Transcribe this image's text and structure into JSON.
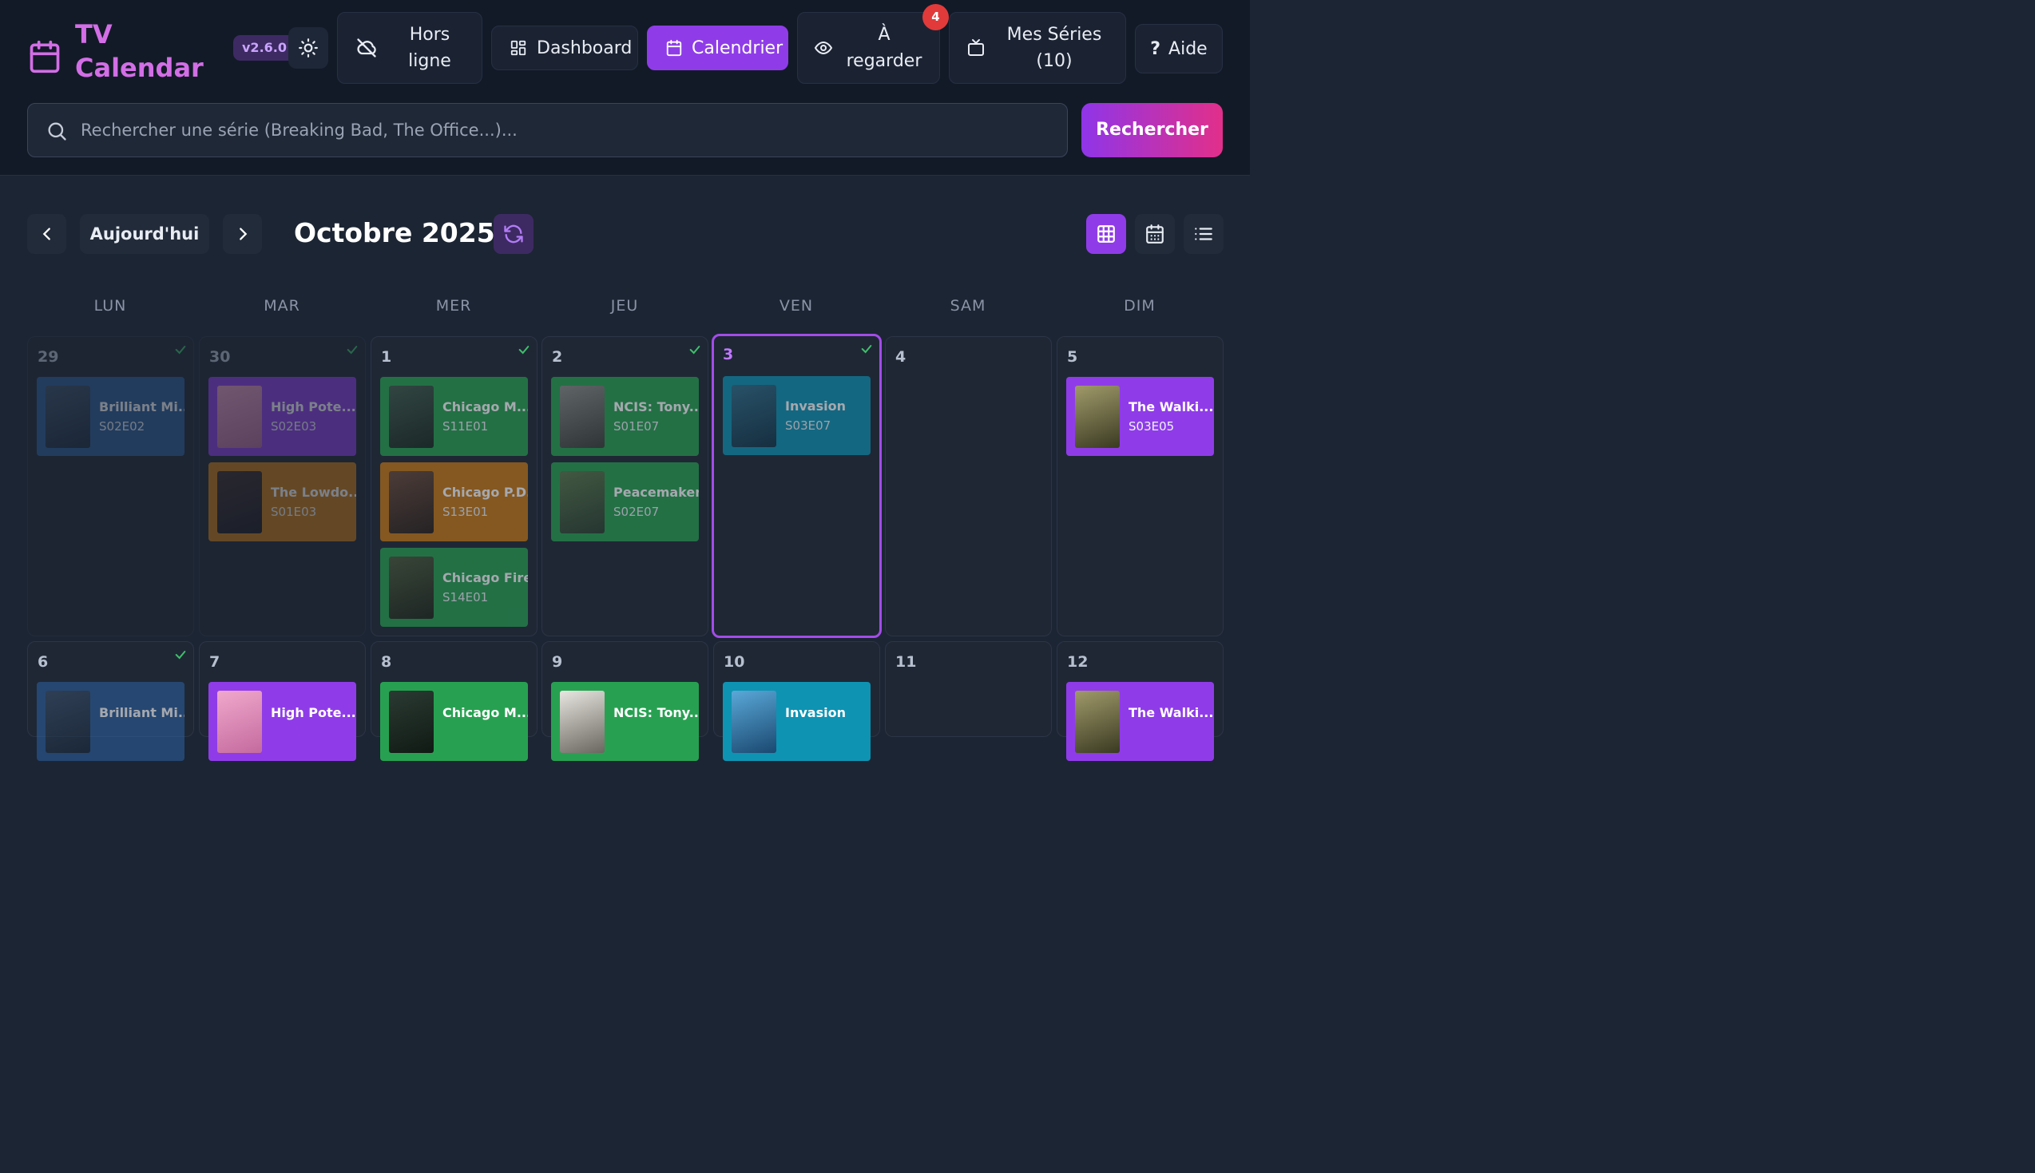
{
  "app": {
    "title": "TV\nCalendar",
    "version": "v2.6.0"
  },
  "nav": {
    "offline": "Hors\nligne",
    "dashboard": "Dashboard",
    "calendar": "Calendrier",
    "watch": "À\nregarder",
    "watch_badge": "4",
    "series": "Mes Séries\n(10)",
    "help": "Aide",
    "help_mark": "?"
  },
  "search": {
    "placeholder": "Rechercher une série (Breaking Bad, The Office...)...",
    "button": "Rechercher"
  },
  "toolbar": {
    "today": "Aujourd'hui",
    "month": "Octobre 2025"
  },
  "days_of_week": [
    "LUN",
    "MAR",
    "MER",
    "JEU",
    "VEN",
    "SAM",
    "DIM"
  ],
  "week1": [
    {
      "day": "29",
      "episodes": [
        {
          "title": "Brilliant Mi...",
          "code": "S02E02"
        }
      ]
    },
    {
      "day": "30",
      "episodes": [
        {
          "title": "High Pote...",
          "code": "S02E03"
        },
        {
          "title": "The Lowdo...",
          "code": "S01E03"
        }
      ]
    },
    {
      "day": "1",
      "episodes": [
        {
          "title": "Chicago M...",
          "code": "S11E01"
        },
        {
          "title": "Chicago P.D.",
          "code": "S13E01"
        },
        {
          "title": "Chicago Fire",
          "code": "S14E01"
        }
      ]
    },
    {
      "day": "2",
      "episodes": [
        {
          "title": "NCIS: Tony...",
          "code": "S01E07"
        },
        {
          "title": "Peacemaker",
          "code": "S02E07"
        }
      ]
    },
    {
      "day": "3",
      "episodes": [
        {
          "title": "Invasion",
          "code": "S03E07"
        }
      ]
    },
    {
      "day": "4",
      "episodes": []
    },
    {
      "day": "5",
      "episodes": [
        {
          "title": "The Walki...",
          "code": "S03E05"
        }
      ]
    }
  ],
  "week2": [
    {
      "day": "6",
      "episodes": [
        {
          "title": "Brilliant Mi..."
        }
      ]
    },
    {
      "day": "7",
      "episodes": [
        {
          "title": "High Pote..."
        }
      ]
    },
    {
      "day": "8",
      "episodes": [
        {
          "title": "Chicago M..."
        }
      ]
    },
    {
      "day": "9",
      "episodes": [
        {
          "title": "NCIS: Tony..."
        }
      ]
    },
    {
      "day": "10",
      "episodes": [
        {
          "title": "Invasion"
        }
      ]
    },
    {
      "day": "11",
      "episodes": []
    },
    {
      "day": "12",
      "episodes": [
        {
          "title": "The Walki..."
        }
      ]
    }
  ],
  "colors": {
    "accent": "#8f3ce8",
    "green": "#27a151",
    "orange": "#c97a14",
    "blue": "#2c5d9a",
    "teal": "#0e93b3",
    "badge": "#e23a3a"
  },
  "icons": {
    "logo": "calendar-icon",
    "theme": "sun-icon",
    "offline": "cloud-off-icon",
    "dashboard": "grid-icon",
    "calendar": "calendar-icon",
    "watch": "eye-icon",
    "series": "tv-icon",
    "search": "search-icon",
    "prev": "chevron-left-icon",
    "next": "chevron-right-icon",
    "refresh": "refresh-icon",
    "view_grid": "table-grid-icon",
    "view_calendar": "calendar-days-icon",
    "view_list": "list-icon",
    "watched": "check-icon"
  }
}
